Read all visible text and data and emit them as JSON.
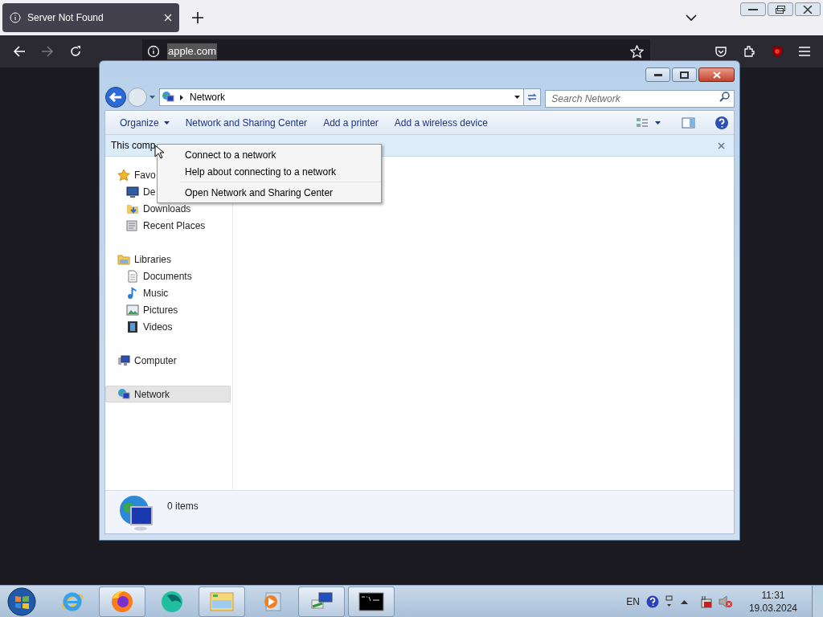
{
  "browser": {
    "tab": {
      "title": "Server Not Found"
    },
    "url": "apple.com"
  },
  "explorer": {
    "breadcrumb": "Network",
    "search": {
      "placeholder": "Search Network"
    },
    "commands": [
      {
        "label": "Organize",
        "dropdown": true
      },
      {
        "label": "Network and Sharing Center",
        "dropdown": false
      },
      {
        "label": "Add a printer",
        "dropdown": false
      },
      {
        "label": "Add a wireless device",
        "dropdown": false
      }
    ],
    "info_bar": "This comp",
    "context_menu": [
      {
        "kind": "item",
        "label": "Connect to a network"
      },
      {
        "kind": "item",
        "label": "Help about connecting to a network"
      },
      {
        "kind": "separator"
      },
      {
        "kind": "item",
        "label": "Open Network and Sharing Center"
      }
    ],
    "nav": [
      {
        "label": "Favo",
        "selected": false,
        "children": [
          {
            "label": "De",
            "selected": false
          },
          {
            "label": "Downloads",
            "selected": false
          },
          {
            "label": "Recent Places",
            "selected": false
          }
        ]
      },
      {
        "label": "Libraries",
        "selected": false,
        "children": [
          {
            "label": "Documents",
            "selected": false
          },
          {
            "label": "Music",
            "selected": false
          },
          {
            "label": "Pictures",
            "selected": false
          },
          {
            "label": "Videos",
            "selected": false
          }
        ]
      },
      {
        "label": "Computer",
        "selected": false
      },
      {
        "label": "Network",
        "selected": true
      }
    ],
    "status": "0 items"
  },
  "taskbar": {
    "apps": [
      {
        "kind": "ie",
        "running": false
      },
      {
        "kind": "firefox",
        "running": true
      },
      {
        "kind": "sphere",
        "running": false
      },
      {
        "kind": "folder",
        "running": true
      },
      {
        "kind": "media",
        "running": false
      },
      {
        "kind": "network",
        "running": true
      },
      {
        "kind": "cmd",
        "running": true
      }
    ],
    "language": "EN",
    "time": "11:31",
    "date": "19.03.2024"
  }
}
